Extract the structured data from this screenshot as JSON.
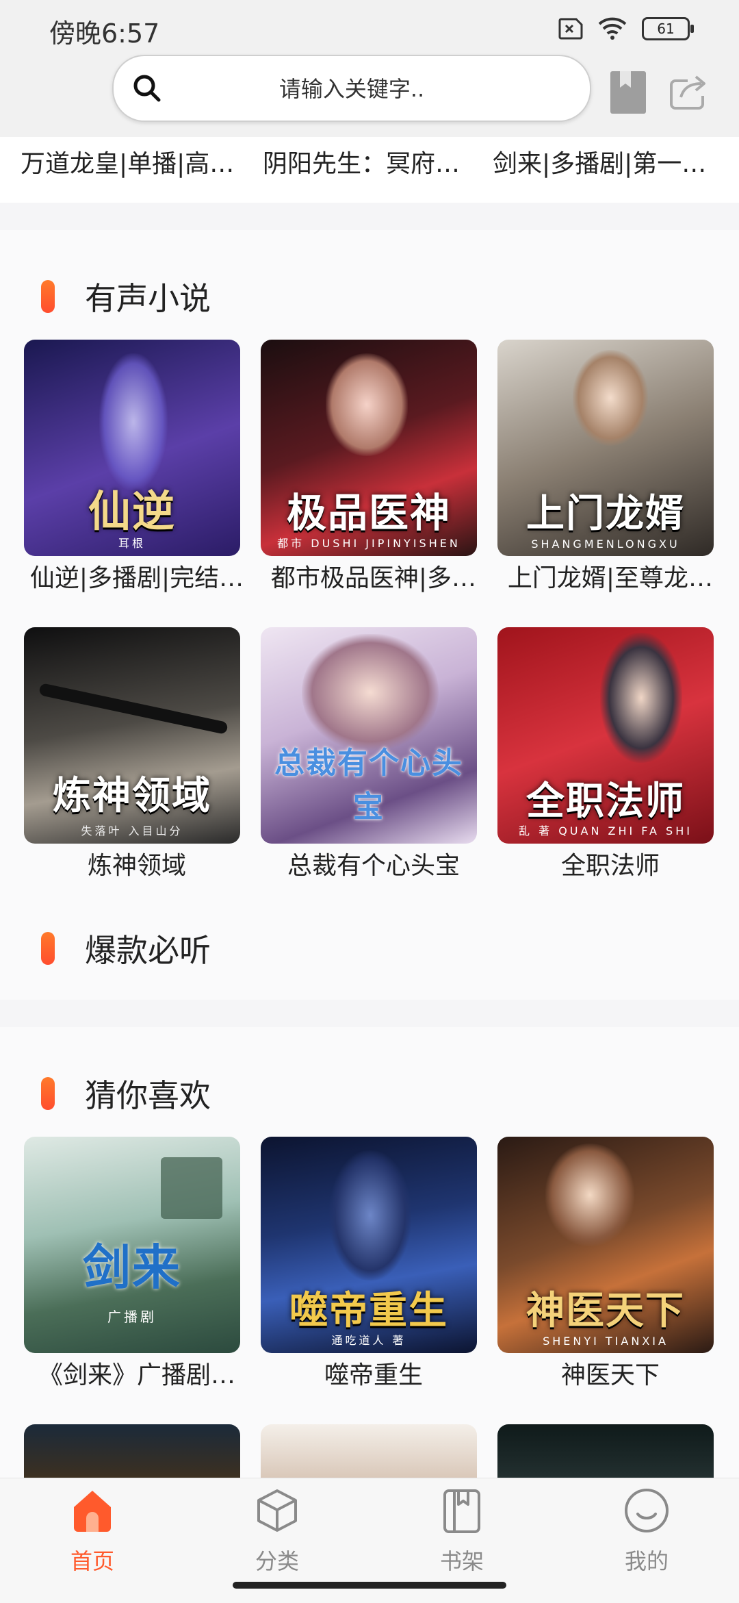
{
  "status": {
    "time": "傍晚6:57",
    "battery": "61"
  },
  "search": {
    "placeholder": "请输入关键字.."
  },
  "marquee": [
    "万道龙皇|单播|高…",
    "阴阳先生：冥府…",
    "剑来|多播剧|第一…"
  ],
  "sections": {
    "audio": {
      "title": "有声小说",
      "items": [
        {
          "label": "仙逆|多播剧|完结…",
          "cover_text": "仙逆",
          "cover_sub": "耳根",
          "colors": [
            "#1a1850",
            "#5b3fa8"
          ]
        },
        {
          "label": "都市极品医神|多…",
          "cover_text": "极品医神",
          "cover_sub": "都市 DUSHI JIPINYISHEN",
          "colors": [
            "#2a1414",
            "#c8303a"
          ]
        },
        {
          "label": "上门龙婿|至尊龙…",
          "cover_text": "上门龙婿",
          "cover_sub": "SHANGMENLONGXU",
          "colors": [
            "#3a3430",
            "#cfc6b8"
          ]
        },
        {
          "label": "炼神领域",
          "cover_text": "炼神领域",
          "cover_sub": "失落叶  入目山分",
          "colors": [
            "#1c1c1c",
            "#8a8378"
          ]
        },
        {
          "label": "总裁有个心头宝",
          "cover_text": "总裁有个心头宝",
          "cover_sub": "",
          "colors": [
            "#d9cbe6",
            "#6b4f86"
          ]
        },
        {
          "label": "全职法师",
          "cover_text": "全职法师",
          "cover_sub": "乱 著  QUAN ZHI FA SHI",
          "colors": [
            "#7a1018",
            "#d8333e"
          ]
        }
      ]
    },
    "hot": {
      "title": "爆款必听"
    },
    "guess": {
      "title": "猜你喜欢",
      "items": [
        {
          "label": "《剑来》广播剧…",
          "cover_text": "剑来",
          "cover_sub": "广播剧",
          "colors": [
            "#2c4a3e",
            "#b9d3c9"
          ]
        },
        {
          "label": "噬帝重生",
          "cover_text": "噬帝重生",
          "cover_sub": "通吃道人 著",
          "colors": [
            "#0c1430",
            "#3a5fb8"
          ]
        },
        {
          "label": "神医天下",
          "cover_text": "神医天下",
          "cover_sub": "SHENYI TIANXIA",
          "colors": [
            "#2a1a14",
            "#c6713a"
          ]
        }
      ]
    }
  },
  "tabs": [
    {
      "label": "首页",
      "icon": "home-icon",
      "active": true
    },
    {
      "label": "分类",
      "icon": "category-icon",
      "active": false
    },
    {
      "label": "书架",
      "icon": "bookshelf-icon",
      "active": false
    },
    {
      "label": "我的",
      "icon": "profile-icon",
      "active": false
    }
  ],
  "colors": {
    "accent": "#ff5a2c"
  }
}
